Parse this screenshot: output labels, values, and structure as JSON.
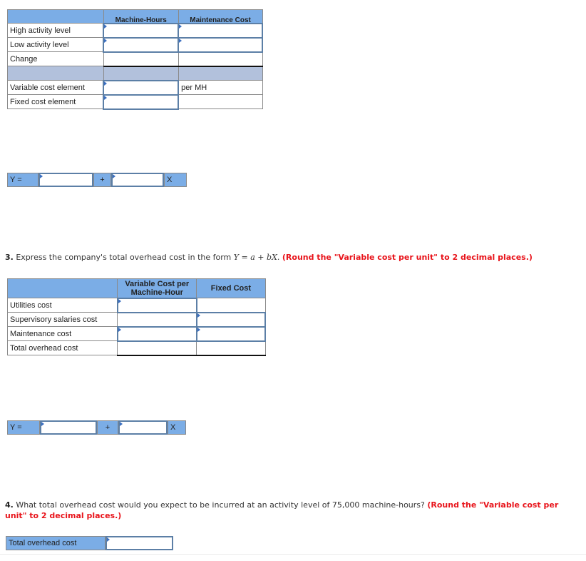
{
  "table1": {
    "headers": [
      "",
      "Machine-Hours",
      "Maintenance Cost"
    ],
    "rows": [
      {
        "label": "High activity level",
        "col1": "",
        "col2": ""
      },
      {
        "label": "Low activity level",
        "col1": "",
        "col2": ""
      },
      {
        "label": "Change",
        "col1": "",
        "col2": ""
      },
      {
        "label": "",
        "col1": "",
        "col2": ""
      },
      {
        "label": "Variable cost element",
        "col1": "",
        "col2": "per MH"
      },
      {
        "label": "Fixed cost element",
        "col1": "",
        "col2": ""
      }
    ]
  },
  "equation1": {
    "y_label": "Y =",
    "a_value": "",
    "plus": "+",
    "b_value": "",
    "x_label": "X"
  },
  "question3": {
    "number": "3.",
    "text": "Express the company's total overhead cost in the form",
    "formula": "Y = a + bX.",
    "instruction": "(Round the \"Variable cost per unit\" to 2 decimal places.)"
  },
  "table2": {
    "headers": [
      "",
      "Variable Cost per Machine-Hour",
      "Fixed Cost"
    ],
    "rows": [
      {
        "label": "Utilities cost",
        "variable": "",
        "fixed": ""
      },
      {
        "label": "Supervisory salaries cost",
        "variable": "",
        "fixed": ""
      },
      {
        "label": "Maintenance cost",
        "variable": "",
        "fixed": ""
      },
      {
        "label": "Total overhead cost",
        "variable": "",
        "fixed": ""
      }
    ]
  },
  "equation2": {
    "y_label": "Y =",
    "a_value": "",
    "plus": "+",
    "b_value": "",
    "x_label": "X"
  },
  "question4": {
    "number": "4.",
    "text": "What total overhead cost would you expect to be incurred at an activity level of 75,000 machine-hours?",
    "instruction": "(Round the \"Variable cost per unit\" to 2 decimal places.)"
  },
  "answer4": {
    "label": "Total overhead cost",
    "value": ""
  }
}
